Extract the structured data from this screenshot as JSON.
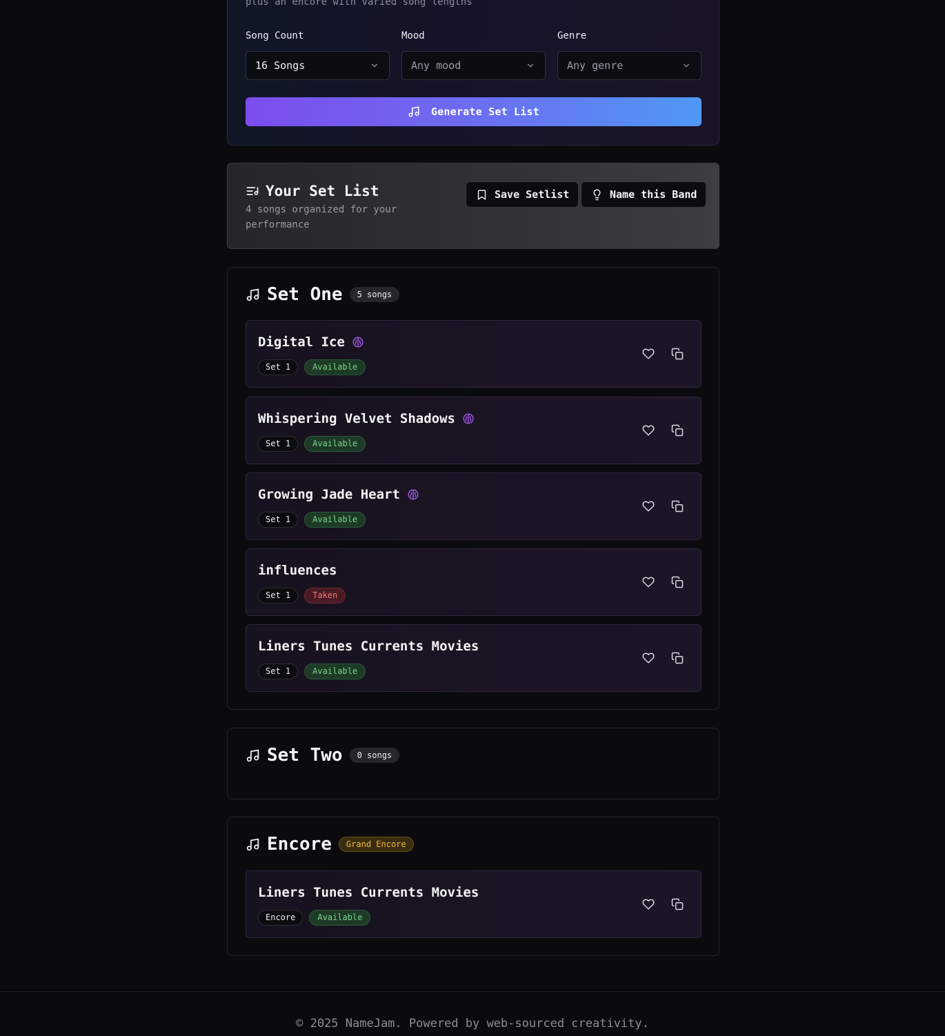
{
  "generator": {
    "description": "plus an encore with varied song lengths",
    "song_count": {
      "label": "Song Count",
      "value": "16 Songs"
    },
    "mood": {
      "label": "Mood",
      "value": "Any mood"
    },
    "genre": {
      "label": "Genre",
      "value": "Any genre"
    },
    "generate_label": "Generate Set List"
  },
  "setlist": {
    "title": "Your Set List",
    "subtitle": "4 songs organized for your performance",
    "save_label": "Save Setlist",
    "name_band_label": "Name this Band"
  },
  "set_one": {
    "title": "Set One",
    "badge": "5 songs",
    "songs": [
      {
        "title": "Digital Ice",
        "tag": "Set 1",
        "status": "Available",
        "ai": true
      },
      {
        "title": "Whispering Velvet Shadows",
        "tag": "Set 1",
        "status": "Available",
        "ai": true
      },
      {
        "title": "Growing Jade Heart",
        "tag": "Set 1",
        "status": "Available",
        "ai": true
      },
      {
        "title": "influences",
        "tag": "Set 1",
        "status": "Taken",
        "ai": false
      },
      {
        "title": "Liners Tunes Currents Movies",
        "tag": "Set 1",
        "status": "Available",
        "ai": false
      }
    ]
  },
  "set_two": {
    "title": "Set Two",
    "badge": "0 songs"
  },
  "encore": {
    "title": "Encore",
    "badge": "Grand Encore",
    "songs": [
      {
        "title": "Liners Tunes Currents Movies",
        "tag": "Encore",
        "status": "Available",
        "ai": false
      }
    ]
  },
  "footer": {
    "text": "© 2025 NameJam. Powered by web-sourced creativity."
  },
  "colors": {
    "accent_purple": "#7c4dee",
    "accent_blue": "#4f98f6",
    "available_green": "#7ad48e",
    "taken_red": "#f07a7a",
    "encore_gold": "#f0b93a"
  }
}
